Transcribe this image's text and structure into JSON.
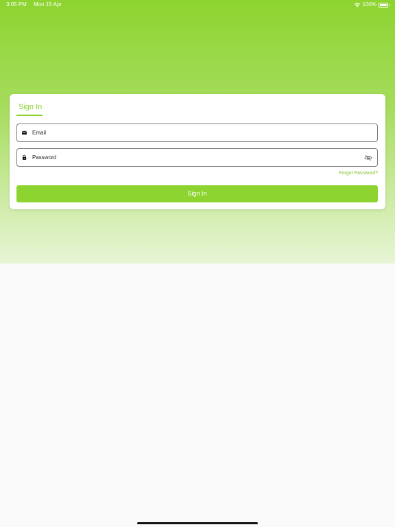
{
  "status_bar": {
    "time": "3:05 PM",
    "date": "Mon 15 Apr",
    "battery": "100%",
    "icons": [
      "wifi-icon",
      "battery-icon"
    ]
  },
  "card": {
    "tab_label": "Sign In",
    "email": {
      "placeholder": "Email",
      "value": "",
      "icon": "mail-icon"
    },
    "password": {
      "placeholder": "Password",
      "value": "",
      "icon": "lock-icon",
      "toggle_icon": "eye-off-icon"
    },
    "forgot_label": "Forgot Password?",
    "submit_label": "Sign In"
  },
  "colors": {
    "accent": "#8dd430",
    "link": "#7cc224",
    "background": "#fafafa"
  }
}
